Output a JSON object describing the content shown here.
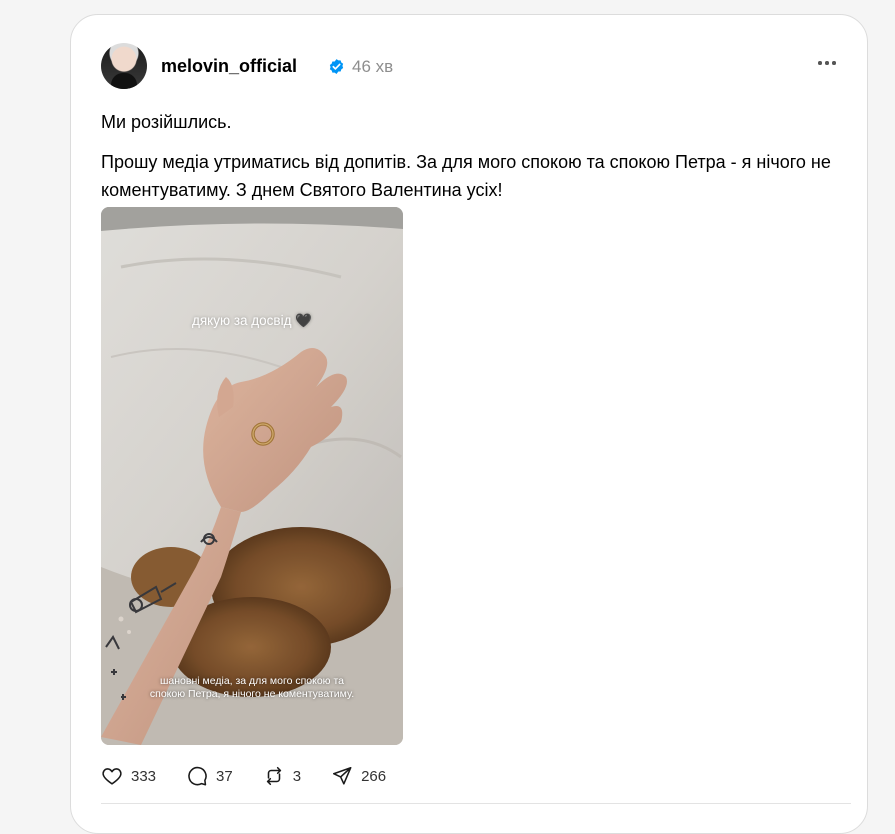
{
  "post": {
    "username": "melovin_official",
    "time": "46 хв",
    "text_line1": "Ми розійшлись.",
    "text_line2": "Прошу медіа утриматись від допитів. За для мого спокою та спокою Петра - я нічого не коментуватиму. З днем Святого Валентина усіх!",
    "image": {
      "caption_top": "дякую за досвід 🖤",
      "caption_bottom": "шановні медіа, за для мого спокою та спокою Петра, я нічого не коментуватиму."
    },
    "actions": {
      "likes": "333",
      "comments": "37",
      "reposts": "3",
      "shares": "266"
    }
  },
  "icons": {
    "verified": "verified-badge-icon",
    "more": "more-horizontal-icon",
    "like": "heart-icon",
    "comment": "comment-icon",
    "repost": "repost-icon",
    "share": "send-icon"
  },
  "colors": {
    "verified_blue": "#0095f6",
    "muted_text": "#8e8e8e"
  }
}
